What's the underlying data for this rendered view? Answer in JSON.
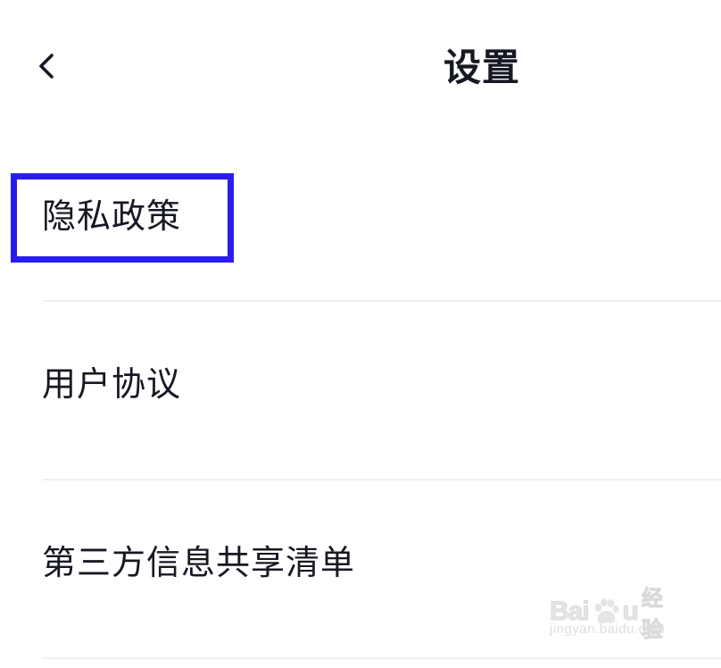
{
  "header": {
    "back_icon": "chevron-left-icon",
    "title": "设置"
  },
  "settings_list": {
    "items": [
      {
        "label": "隐私政策"
      },
      {
        "label": "用户协议"
      },
      {
        "label": "第三方信息共享清单"
      }
    ]
  },
  "annotation": {
    "highlight_color": "#2a1cf0",
    "highlighted_item": "隐私政策"
  },
  "watermark": {
    "logo_text_left": "Bai",
    "logo_text_right": "u",
    "logo_text_cn": "经验",
    "url": "jingyan.baidu.com"
  },
  "colors": {
    "text": "#161823",
    "divider": "#f0f0f1",
    "background": "#ffffff"
  }
}
